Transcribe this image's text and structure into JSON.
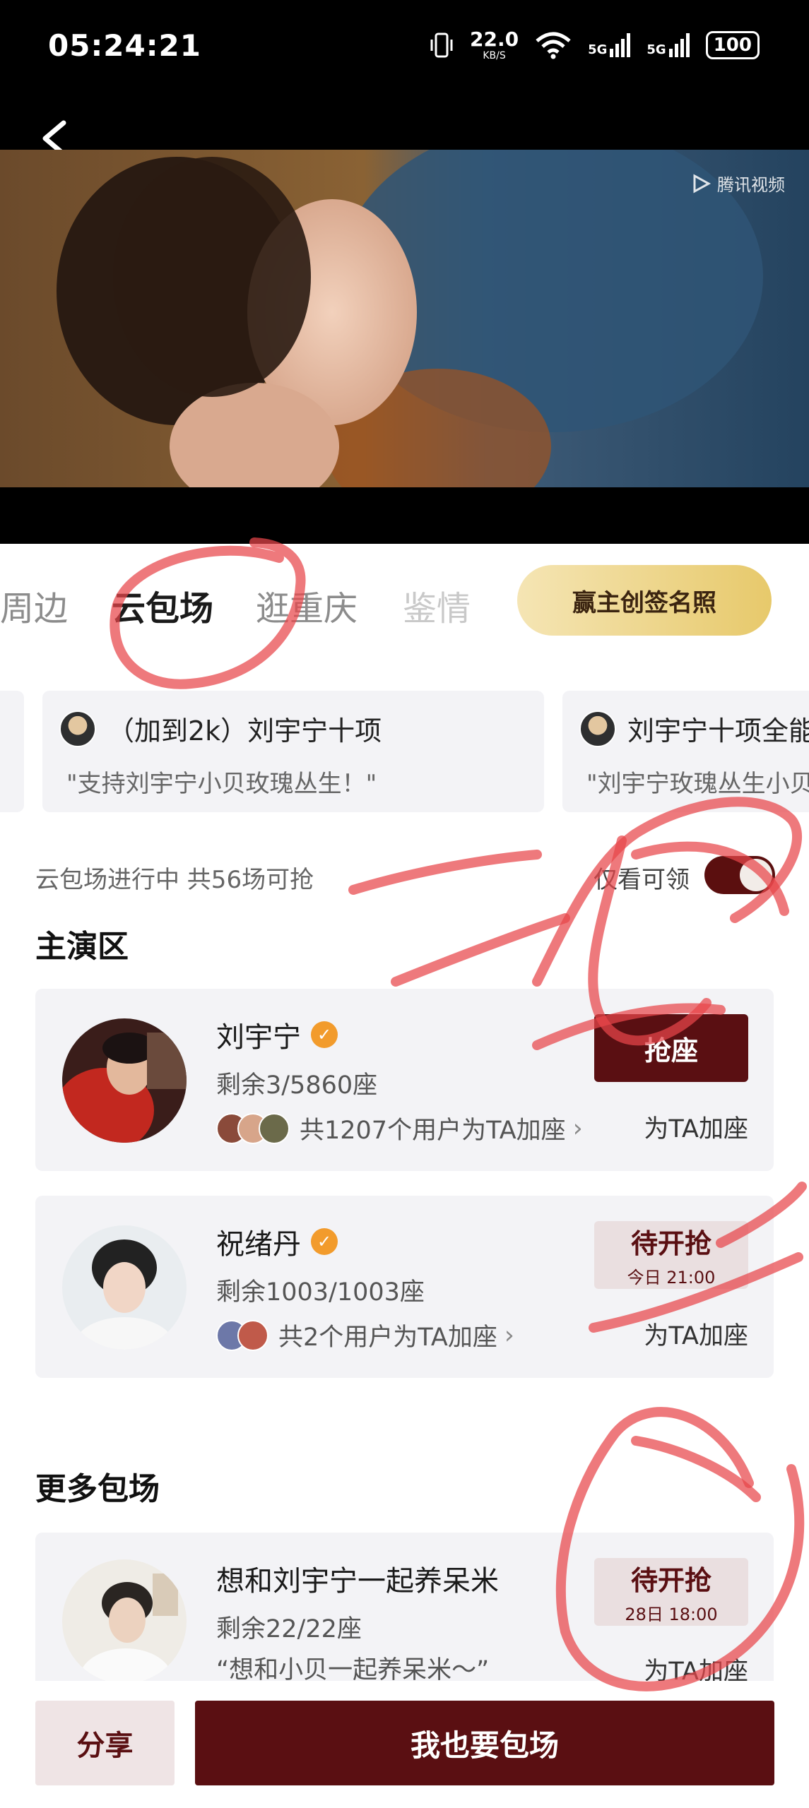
{
  "status_bar": {
    "time": "05:24:21",
    "net_speed": "22.0",
    "net_unit": "KB/S",
    "net_5g_1": "5G",
    "net_5g_2": "5G",
    "battery": "100"
  },
  "video": {
    "watermark": "腾讯视频"
  },
  "tabs": [
    "周边",
    "云包场",
    "逛重庆",
    "鉴情"
  ],
  "promo_button": "赢主创签名照",
  "ticker": [
    {
      "title": "（加到2k）刘宇宁十项",
      "quote": "\"支持刘宇宁小贝玫瑰丛生！\""
    },
    {
      "title": "刘宇宁十项全能",
      "quote": "\"刘宇宁玫瑰丛生小贝"
    }
  ],
  "status_line": "云包场进行中 共56场可抢",
  "filter": {
    "label": "仅看可领",
    "on": true
  },
  "sections": {
    "main_area": "主演区",
    "more": "更多包场"
  },
  "cards": [
    {
      "name": "刘宇宁",
      "verified": true,
      "remain": "剩余3/5860座",
      "support": "共1207个用户为TA加座",
      "action": "抢座",
      "add_seat": "为TA加座"
    },
    {
      "name": "祝绪丹",
      "verified": true,
      "remain": "剩余1003/1003座",
      "support": "共2个用户为TA加座",
      "action": "待开抢",
      "action_time": "今日 21:00",
      "add_seat": "为TA加座"
    },
    {
      "name": "想和刘宇宁一起养呆米",
      "verified": false,
      "remain": "剩余22/22座",
      "support": "“想和小贝一起养呆米～”",
      "action": "待开抢",
      "action_time": "28日 18:00",
      "add_seat": "为TA加座"
    }
  ],
  "bottom": {
    "share": "分享",
    "main": "我也要包场"
  },
  "colors": {
    "accent": "#5a0f12",
    "pending_bg": "#eadfe0",
    "card_bg": "#f3f3f6",
    "promo_gold": "#e7c96b",
    "verified": "#f29b2c",
    "annotation": "#e8454a"
  }
}
